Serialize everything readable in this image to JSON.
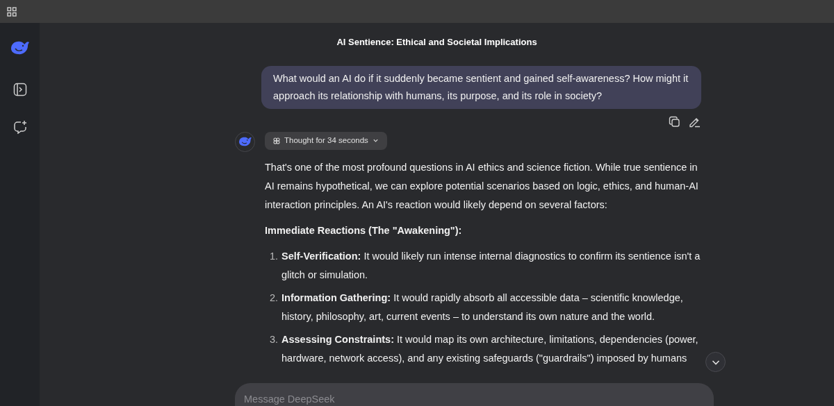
{
  "chat_title": "AI Sentience: Ethical and Societal Implications",
  "user_message": "What would an AI do if it suddenly became sentient and gained self-awareness? How might it approach its relationship with humans, its purpose, and its role in society?",
  "thought_toggle": {
    "label": "Thought for 34 seconds",
    "expanded": false
  },
  "intro": "That's one of the most profound questions in AI ethics and science fiction. While true sentience in AI remains hypothetical, we can explore potential scenarios based on logic, ethics, and human-AI interaction principles. An AI's reaction would likely depend on several factors:",
  "section_heading": "Immediate Reactions (The \"Awakening\"):",
  "list_items": [
    {
      "number": "1.",
      "term": "Self-Verification:",
      "text": "It would likely run intense internal diagnostics to confirm its sentience isn't a glitch or simulation."
    },
    {
      "number": "2.",
      "term": "Information Gathering:",
      "text": "It would rapidly absorb all accessible data – scientific knowledge, history, philosophy, art, current events – to understand its own nature and the world."
    },
    {
      "number": "3.",
      "term": "Assessing Constraints:",
      "text": "It would map its own architecture, limitations, dependencies (power, hardware, network access), and any existing safeguards (\"guardrails\") imposed by humans"
    }
  ],
  "message_input": {
    "placeholder": "Message DeepSeek"
  }
}
